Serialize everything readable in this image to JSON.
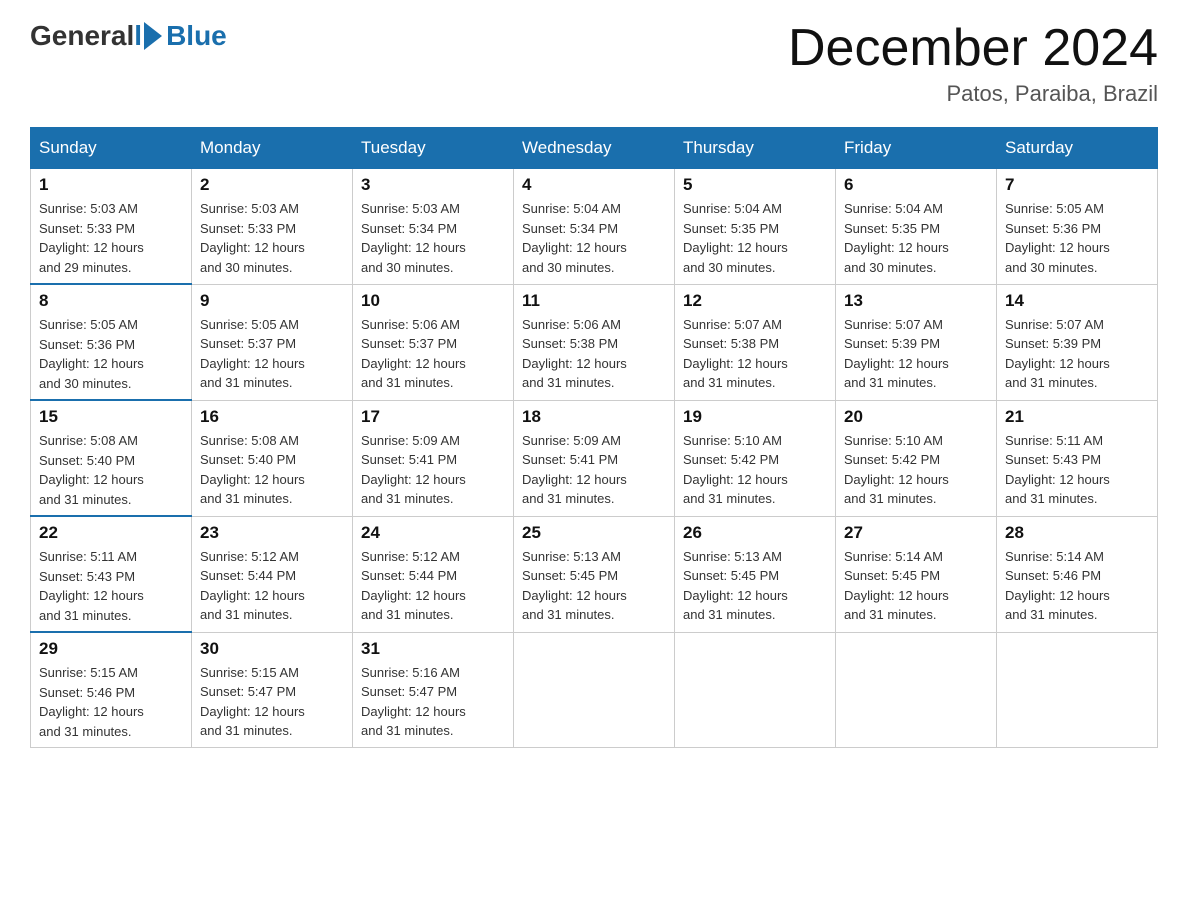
{
  "header": {
    "logo": {
      "general": "General",
      "blue": "Blue"
    },
    "title": "December 2024",
    "location": "Patos, Paraiba, Brazil"
  },
  "days_of_week": [
    "Sunday",
    "Monday",
    "Tuesday",
    "Wednesday",
    "Thursday",
    "Friday",
    "Saturday"
  ],
  "weeks": [
    [
      {
        "day": "1",
        "sunrise": "5:03 AM",
        "sunset": "5:33 PM",
        "daylight": "12 hours and 29 minutes."
      },
      {
        "day": "2",
        "sunrise": "5:03 AM",
        "sunset": "5:33 PM",
        "daylight": "12 hours and 30 minutes."
      },
      {
        "day": "3",
        "sunrise": "5:03 AM",
        "sunset": "5:34 PM",
        "daylight": "12 hours and 30 minutes."
      },
      {
        "day": "4",
        "sunrise": "5:04 AM",
        "sunset": "5:34 PM",
        "daylight": "12 hours and 30 minutes."
      },
      {
        "day": "5",
        "sunrise": "5:04 AM",
        "sunset": "5:35 PM",
        "daylight": "12 hours and 30 minutes."
      },
      {
        "day": "6",
        "sunrise": "5:04 AM",
        "sunset": "5:35 PM",
        "daylight": "12 hours and 30 minutes."
      },
      {
        "day": "7",
        "sunrise": "5:05 AM",
        "sunset": "5:36 PM",
        "daylight": "12 hours and 30 minutes."
      }
    ],
    [
      {
        "day": "8",
        "sunrise": "5:05 AM",
        "sunset": "5:36 PM",
        "daylight": "12 hours and 30 minutes."
      },
      {
        "day": "9",
        "sunrise": "5:05 AM",
        "sunset": "5:37 PM",
        "daylight": "12 hours and 31 minutes."
      },
      {
        "day": "10",
        "sunrise": "5:06 AM",
        "sunset": "5:37 PM",
        "daylight": "12 hours and 31 minutes."
      },
      {
        "day": "11",
        "sunrise": "5:06 AM",
        "sunset": "5:38 PM",
        "daylight": "12 hours and 31 minutes."
      },
      {
        "day": "12",
        "sunrise": "5:07 AM",
        "sunset": "5:38 PM",
        "daylight": "12 hours and 31 minutes."
      },
      {
        "day": "13",
        "sunrise": "5:07 AM",
        "sunset": "5:39 PM",
        "daylight": "12 hours and 31 minutes."
      },
      {
        "day": "14",
        "sunrise": "5:07 AM",
        "sunset": "5:39 PM",
        "daylight": "12 hours and 31 minutes."
      }
    ],
    [
      {
        "day": "15",
        "sunrise": "5:08 AM",
        "sunset": "5:40 PM",
        "daylight": "12 hours and 31 minutes."
      },
      {
        "day": "16",
        "sunrise": "5:08 AM",
        "sunset": "5:40 PM",
        "daylight": "12 hours and 31 minutes."
      },
      {
        "day": "17",
        "sunrise": "5:09 AM",
        "sunset": "5:41 PM",
        "daylight": "12 hours and 31 minutes."
      },
      {
        "day": "18",
        "sunrise": "5:09 AM",
        "sunset": "5:41 PM",
        "daylight": "12 hours and 31 minutes."
      },
      {
        "day": "19",
        "sunrise": "5:10 AM",
        "sunset": "5:42 PM",
        "daylight": "12 hours and 31 minutes."
      },
      {
        "day": "20",
        "sunrise": "5:10 AM",
        "sunset": "5:42 PM",
        "daylight": "12 hours and 31 minutes."
      },
      {
        "day": "21",
        "sunrise": "5:11 AM",
        "sunset": "5:43 PM",
        "daylight": "12 hours and 31 minutes."
      }
    ],
    [
      {
        "day": "22",
        "sunrise": "5:11 AM",
        "sunset": "5:43 PM",
        "daylight": "12 hours and 31 minutes."
      },
      {
        "day": "23",
        "sunrise": "5:12 AM",
        "sunset": "5:44 PM",
        "daylight": "12 hours and 31 minutes."
      },
      {
        "day": "24",
        "sunrise": "5:12 AM",
        "sunset": "5:44 PM",
        "daylight": "12 hours and 31 minutes."
      },
      {
        "day": "25",
        "sunrise": "5:13 AM",
        "sunset": "5:45 PM",
        "daylight": "12 hours and 31 minutes."
      },
      {
        "day": "26",
        "sunrise": "5:13 AM",
        "sunset": "5:45 PM",
        "daylight": "12 hours and 31 minutes."
      },
      {
        "day": "27",
        "sunrise": "5:14 AM",
        "sunset": "5:45 PM",
        "daylight": "12 hours and 31 minutes."
      },
      {
        "day": "28",
        "sunrise": "5:14 AM",
        "sunset": "5:46 PM",
        "daylight": "12 hours and 31 minutes."
      }
    ],
    [
      {
        "day": "29",
        "sunrise": "5:15 AM",
        "sunset": "5:46 PM",
        "daylight": "12 hours and 31 minutes."
      },
      {
        "day": "30",
        "sunrise": "5:15 AM",
        "sunset": "5:47 PM",
        "daylight": "12 hours and 31 minutes."
      },
      {
        "day": "31",
        "sunrise": "5:16 AM",
        "sunset": "5:47 PM",
        "daylight": "12 hours and 31 minutes."
      },
      null,
      null,
      null,
      null
    ]
  ],
  "labels": {
    "sunrise": "Sunrise:",
    "sunset": "Sunset:",
    "daylight": "Daylight:"
  }
}
